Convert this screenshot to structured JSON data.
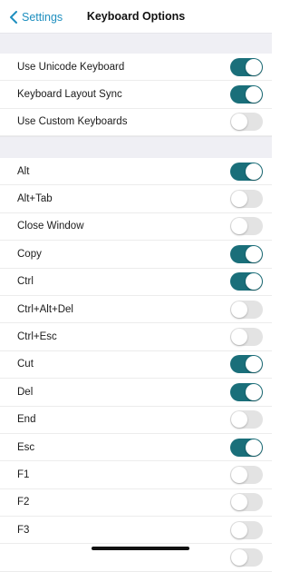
{
  "header": {
    "back_label": "Settings",
    "title": "Keyboard Options"
  },
  "section1": [
    {
      "label": "Use Unicode Keyboard",
      "on": true
    },
    {
      "label": "Keyboard Layout Sync",
      "on": true
    },
    {
      "label": "Use Custom Keyboards",
      "on": false
    }
  ],
  "section2": [
    {
      "label": "Alt",
      "on": true
    },
    {
      "label": "Alt+Tab",
      "on": false
    },
    {
      "label": "Close Window",
      "on": false
    },
    {
      "label": "Copy",
      "on": true
    },
    {
      "label": "Ctrl",
      "on": true
    },
    {
      "label": "Ctrl+Alt+Del",
      "on": false
    },
    {
      "label": "Ctrl+Esc",
      "on": false
    },
    {
      "label": "Cut",
      "on": true
    },
    {
      "label": "Del",
      "on": true
    },
    {
      "label": "End",
      "on": false
    },
    {
      "label": "Esc",
      "on": true
    },
    {
      "label": "F1",
      "on": false
    },
    {
      "label": "F2",
      "on": false
    },
    {
      "label": "F3",
      "on": false
    },
    {
      "label": "",
      "on": false
    }
  ],
  "colors": {
    "accent": "#1f8fbf",
    "toggle_on": "#1a6f7a",
    "toggle_off": "#e3e3e3",
    "section_gap": "#efeff4"
  }
}
